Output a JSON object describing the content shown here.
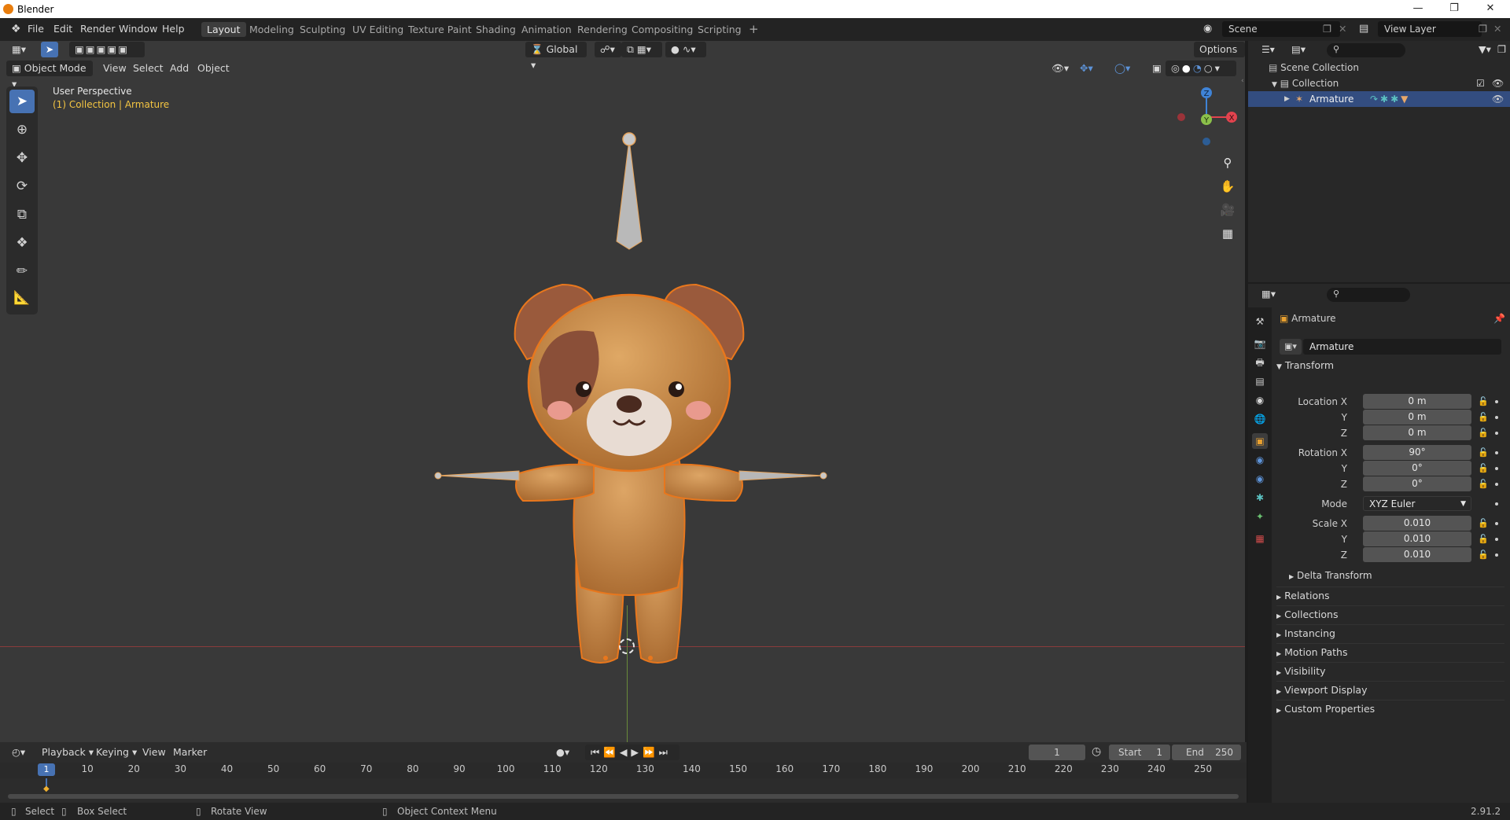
{
  "window": {
    "title": "Blender"
  },
  "menus": [
    "File",
    "Edit",
    "Render",
    "Window",
    "Help"
  ],
  "workspaces": [
    "Layout",
    "Modeling",
    "Sculpting",
    "UV Editing",
    "Texture Paint",
    "Shading",
    "Animation",
    "Rendering",
    "Compositing",
    "Scripting"
  ],
  "scene": {
    "label": "Scene",
    "view_layer": "View Layer"
  },
  "viewport": {
    "mode": "Object Mode",
    "menus": [
      "View",
      "Select",
      "Add",
      "Object"
    ],
    "orientation": "Global",
    "options": "Options",
    "perspective": "User Perspective",
    "collection_info": "(1) Collection | Armature",
    "gizmo": {
      "x": "X",
      "y": "Y",
      "z": "Z"
    }
  },
  "outliner": {
    "scene_collection": "Scene Collection",
    "collection": "Collection",
    "armature": "Armature"
  },
  "properties": {
    "object_name": "Armature",
    "name_field": "Armature",
    "transform_header": "Transform",
    "location_label": "Location X",
    "rotation_label": "Rotation X",
    "scale_label": "Scale X",
    "y_label": "Y",
    "z_label": "Z",
    "mode_label": "Mode",
    "location": [
      "0 m",
      "0 m",
      "0 m"
    ],
    "rotation": [
      "90°",
      "0°",
      "0°"
    ],
    "rotation_mode": "XYZ Euler",
    "scale": [
      "0.010",
      "0.010",
      "0.010"
    ],
    "delta_transform": "Delta Transform",
    "panels": [
      "Relations",
      "Collections",
      "Instancing",
      "Motion Paths",
      "Visibility",
      "Viewport Display",
      "Custom Properties"
    ]
  },
  "timeline": {
    "menus": [
      "Playback",
      "Keying",
      "View",
      "Marker"
    ],
    "current_frame": "1",
    "start_label": "Start",
    "start": "1",
    "end_label": "End",
    "end": "250",
    "ticks": [
      "10",
      "20",
      "30",
      "40",
      "50",
      "60",
      "70",
      "80",
      "90",
      "100",
      "110",
      "120",
      "130",
      "140",
      "150",
      "160",
      "170",
      "180",
      "190",
      "200",
      "210",
      "220",
      "230",
      "240",
      "250"
    ],
    "frame_badge": "1"
  },
  "statusbar": {
    "select": "Select",
    "box_select": "Box Select",
    "rotate_view": "Rotate View",
    "context_menu": "Object Context Menu",
    "version": "2.91.2"
  },
  "colors": {
    "accent": "#4772b3",
    "selection": "#e87d0d",
    "x_axis": "#e2434e",
    "y_axis": "#8bc04a",
    "z_axis": "#3f83d6"
  }
}
